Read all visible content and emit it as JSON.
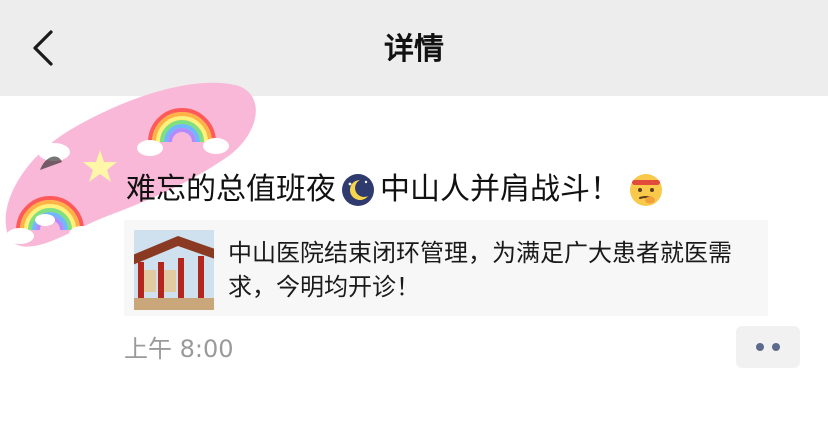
{
  "header": {
    "title": "详情"
  },
  "post": {
    "text_part1": "难忘的总值班夜",
    "text_part2": "中山人并肩战斗！",
    "emoji_1": "moon-night-icon",
    "emoji_2": "thinking-face-icon",
    "link": {
      "title": "中山医院结束闭环管理，为满足广大患者就医需求，今明均开诊！"
    },
    "time": "上午 8:00"
  },
  "icons": {
    "back": "back-chevron-icon",
    "more": "more-dots-icon"
  },
  "colors": {
    "header_bg": "#ededed",
    "card_bg": "#f7f7f7",
    "time_text": "#9a9a9a",
    "more_dots": "#5b6b8c",
    "avatar_pink": "#f9b8d8"
  }
}
